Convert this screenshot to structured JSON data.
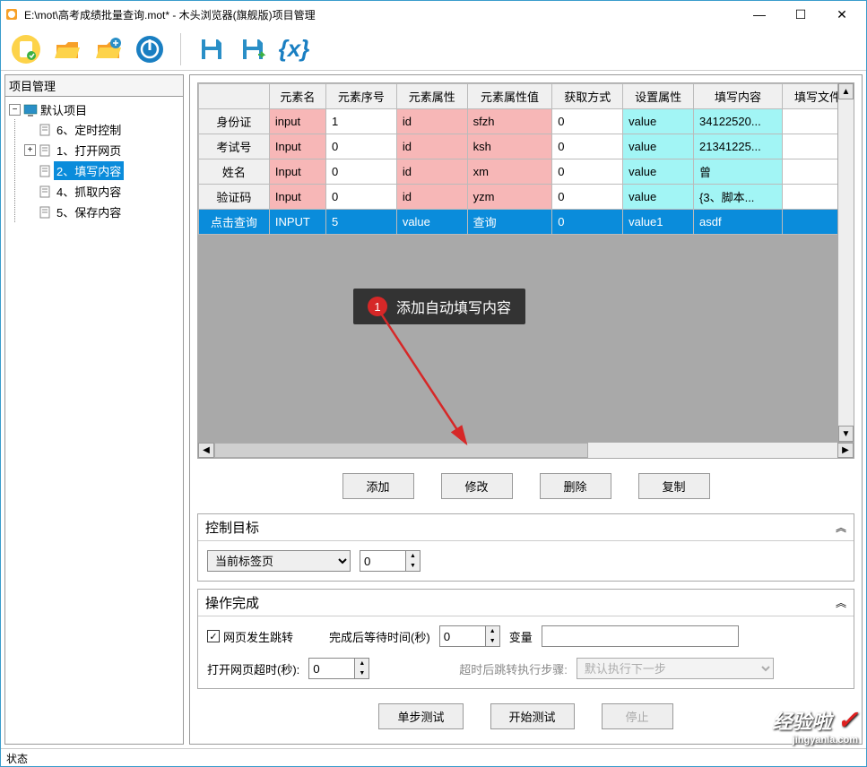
{
  "window": {
    "title": "E:\\mot\\高考成绩批量查询.mot* - 木头浏览器(旗舰版)项目管理"
  },
  "sidebar": {
    "title": "项目管理",
    "root": "默认项目",
    "items": [
      "6、定时控制",
      "1、打开网页",
      "2、填写内容",
      "4、抓取内容",
      "5、保存内容"
    ],
    "selected_index": 2
  },
  "grid": {
    "headers": [
      "",
      "元素名",
      "元素序号",
      "元素属性",
      "元素属性值",
      "获取方式",
      "设置属性",
      "填写内容",
      "填写文件"
    ],
    "rows": [
      {
        "c0": "身份证",
        "c1": "input",
        "c2": "1",
        "c3": "id",
        "c4": "sfzh",
        "c5": "0",
        "c6": "value",
        "c7": "34122520...",
        "c8": ""
      },
      {
        "c0": "考试号",
        "c1": "Input",
        "c2": "0",
        "c3": "id",
        "c4": "ksh",
        "c5": "0",
        "c6": "value",
        "c7": "21341225...",
        "c8": ""
      },
      {
        "c0": "姓名",
        "c1": "Input",
        "c2": "0",
        "c3": "id",
        "c4": "xm",
        "c5": "0",
        "c6": "value",
        "c7": "曾",
        "c8": ""
      },
      {
        "c0": "验证码",
        "c1": "Input",
        "c2": "0",
        "c3": "id",
        "c4": "yzm",
        "c5": "0",
        "c6": "value",
        "c7": "{3、脚本...",
        "c8": ""
      },
      {
        "c0": "点击查询",
        "c1": "INPUT",
        "c2": "5",
        "c3": "value",
        "c4": "查询",
        "c5": "0",
        "c6": "value1",
        "c7": "asdf",
        "c8": ""
      }
    ],
    "buttons": {
      "add": "添加",
      "edit": "修改",
      "del": "删除",
      "copy": "复制"
    }
  },
  "section1": {
    "title": "控制目标",
    "select_value": "当前标签页",
    "spinner_value": "0"
  },
  "section2": {
    "title": "操作完成",
    "checkbox_label": "网页发生跳转",
    "wait_label": "完成后等待时间(秒)",
    "wait_value": "0",
    "var_label": "变量",
    "var_value": "",
    "timeout_label": "打开网页超时(秒):",
    "timeout_value": "0",
    "step_label": "超时后跳转执行步骤:",
    "step_value": "默认执行下一步"
  },
  "test_buttons": {
    "step": "单步测试",
    "start": "开始测试",
    "stop": "停止"
  },
  "callout": {
    "num": "1",
    "text": "添加自动填写内容"
  },
  "statusbar": "状态",
  "watermark": {
    "main": "经验啦",
    "sub": "jingyanla.com"
  }
}
